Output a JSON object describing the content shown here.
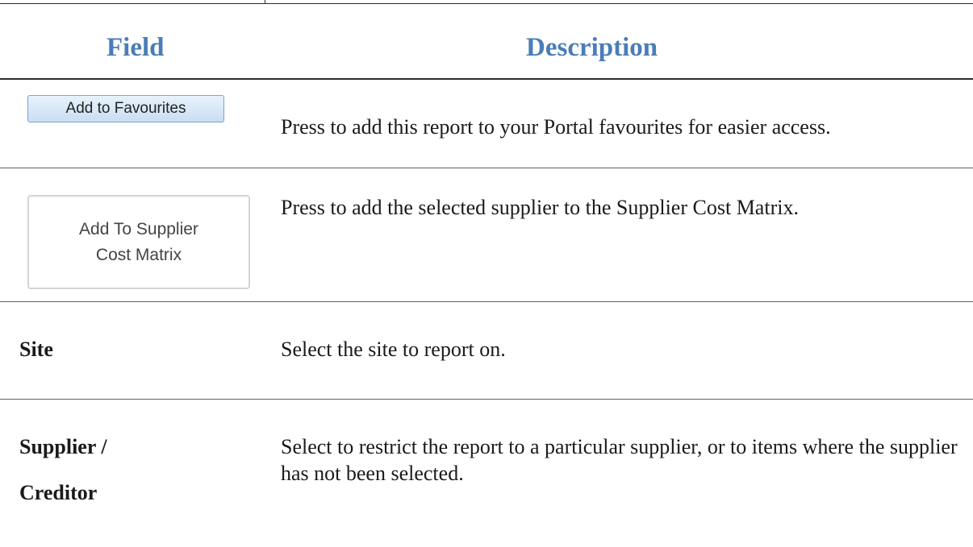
{
  "table": {
    "header": {
      "field": "Field",
      "description": "Description"
    },
    "rows": [
      {
        "field_button": "Add to Favourites",
        "description": "Press to add this report to your Portal favourites for easier access."
      },
      {
        "field_button_lines": [
          "Add To Supplier",
          "Cost Matrix"
        ],
        "description": "Press to add the selected supplier to the Supplier Cost Matrix."
      },
      {
        "field": "Site",
        "description": "Select the site to report on."
      },
      {
        "field_lines": [
          "Supplier /",
          "Creditor"
        ],
        "description": "Select to restrict the report to a particular supplier, or to items where the supplier has not been selected."
      }
    ]
  }
}
